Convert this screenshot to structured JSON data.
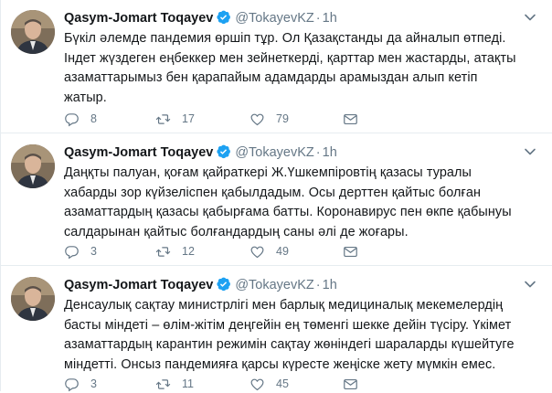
{
  "tweets": [
    {
      "name": "Qasym-Jomart Toqayev",
      "handle": "@TokayevKZ",
      "dot": "·",
      "time": "1h",
      "lines": [
        "Бүкіл әлемде пандемия өршіп тұр. Ол Қазақстанды да айналып өтпеді.",
        "Індет жүздеген еңбеккер мен зейнеткерді, қарттар мен жастарды, атақты",
        "азаматтарымыз бен қарапайым адамдарды арамыздан алып кетіп",
        "жатыр."
      ],
      "replies": "8",
      "retweets": "17",
      "likes": "79"
    },
    {
      "name": "Qasym-Jomart Toqayev",
      "handle": "@TokayevKZ",
      "dot": "·",
      "time": "1h",
      "lines": [
        "Даңқты палуан, қоғам қайраткері Ж.Үшкемпіровтің қазасы туралы",
        "хабарды зор күйзеліспен қабылдадым. Осы дерттен қайтыс болған",
        "азаматтардың қазасы қабырғама батты. Коронавирус пен өкпе қабынуы",
        "салдарынан қайтыс болғандардың саны әлі де жоғары."
      ],
      "replies": "3",
      "retweets": "12",
      "likes": "49"
    },
    {
      "name": "Qasym-Jomart Toqayev",
      "handle": "@TokayevKZ",
      "dot": "·",
      "time": "1h",
      "lines": [
        "Денсаулық сақтау министрлігі мен барлық медициналық мекемелердің",
        "басты міндеті – өлім-жітім деңгейін ең төменгі шекке дейін түсіру. Үкімет",
        "азаматтардың карантин режимін сақтау жөніндегі шараларды күшейтуге",
        "міндетті. Онсыз пандемияға қарсы күресте жеңіске жету мүмкін емес."
      ],
      "replies": "3",
      "retweets": "11",
      "likes": "45"
    }
  ],
  "icons": {
    "verified": "verified-badge-icon",
    "caret": "chevron-down-icon",
    "reply": "reply-icon",
    "retweet": "retweet-icon",
    "like": "heart-icon",
    "dm": "envelope-icon"
  },
  "colors": {
    "verified": "#1da1f2",
    "muted": "#657786",
    "text": "#14171a",
    "divider": "#e6ecf0"
  }
}
